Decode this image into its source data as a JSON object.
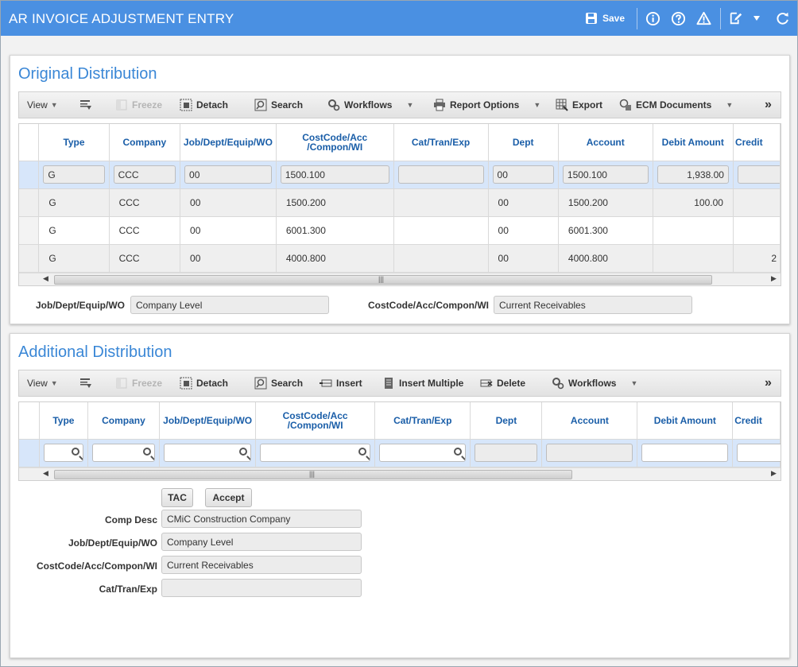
{
  "app": {
    "title": "AR INVOICE ADJUSTMENT ENTRY",
    "save_label": "Save"
  },
  "toolbar_icons": [
    "save-icon",
    "info-icon",
    "help-icon",
    "warning-icon",
    "edit-icon",
    "chevron-down-icon",
    "refresh-icon"
  ],
  "colors": {
    "title_bar": "#4a90e2",
    "panel_title": "#3a87d6",
    "column_header": "#1a5ea8",
    "selected_row": "#d7e6fa"
  },
  "original": {
    "title": "Original Distribution",
    "toolbar": {
      "view": "View",
      "freeze": "Freeze",
      "detach": "Detach",
      "search": "Search",
      "workflows": "Workflows",
      "report_options": "Report Options",
      "export": "Export",
      "ecm_documents": "ECM Documents",
      "more": "»"
    },
    "columns": [
      "Type",
      "Company",
      "Job/Dept/Equip/WO",
      "CostCode/Acc\n/Compon/WI",
      "Cat/Tran/Exp",
      "Dept",
      "Account",
      "Debit Amount",
      "Credit"
    ],
    "rows": [
      [
        "G",
        "CCC",
        "00",
        "1500.100",
        "",
        "00",
        "1500.100",
        "1,938.00",
        ""
      ],
      [
        "G",
        "CCC",
        "00",
        "1500.200",
        "",
        "00",
        "1500.200",
        "100.00",
        ""
      ],
      [
        "G",
        "CCC",
        "00",
        "6001.300",
        "",
        "00",
        "6001.300",
        "",
        ""
      ],
      [
        "G",
        "CCC",
        "00",
        "4000.800",
        "",
        "00",
        "4000.800",
        "",
        "2"
      ]
    ],
    "fields": {
      "job_label": "Job/Dept/Equip/WO",
      "job_value": "Company Level",
      "costcode_label": "CostCode/Acc/Compon/WI",
      "costcode_value": "Current Receivables"
    }
  },
  "additional": {
    "title": "Additional Distribution",
    "toolbar": {
      "view": "View",
      "freeze": "Freeze",
      "detach": "Detach",
      "search": "Search",
      "insert": "Insert",
      "insert_multiple": "Insert Multiple",
      "delete": "Delete",
      "workflows": "Workflows",
      "more": "»"
    },
    "columns": [
      "Type",
      "Company",
      "Job/Dept/Equip/WO",
      "CostCode/Acc\n/Compon/WI",
      "Cat/Tran/Exp",
      "Dept",
      "Account",
      "Debit Amount",
      "Credit"
    ],
    "buttons": {
      "tac": "TAC",
      "accept": "Accept"
    },
    "fields": [
      {
        "label": "Comp Desc",
        "value": "CMiC Construction Company"
      },
      {
        "label": "Job/Dept/Equip/WO",
        "value": "Company Level"
      },
      {
        "label": "CostCode/Acc/Compon/WI",
        "value": "Current Receivables"
      },
      {
        "label": "Cat/Tran/Exp",
        "value": ""
      }
    ]
  }
}
